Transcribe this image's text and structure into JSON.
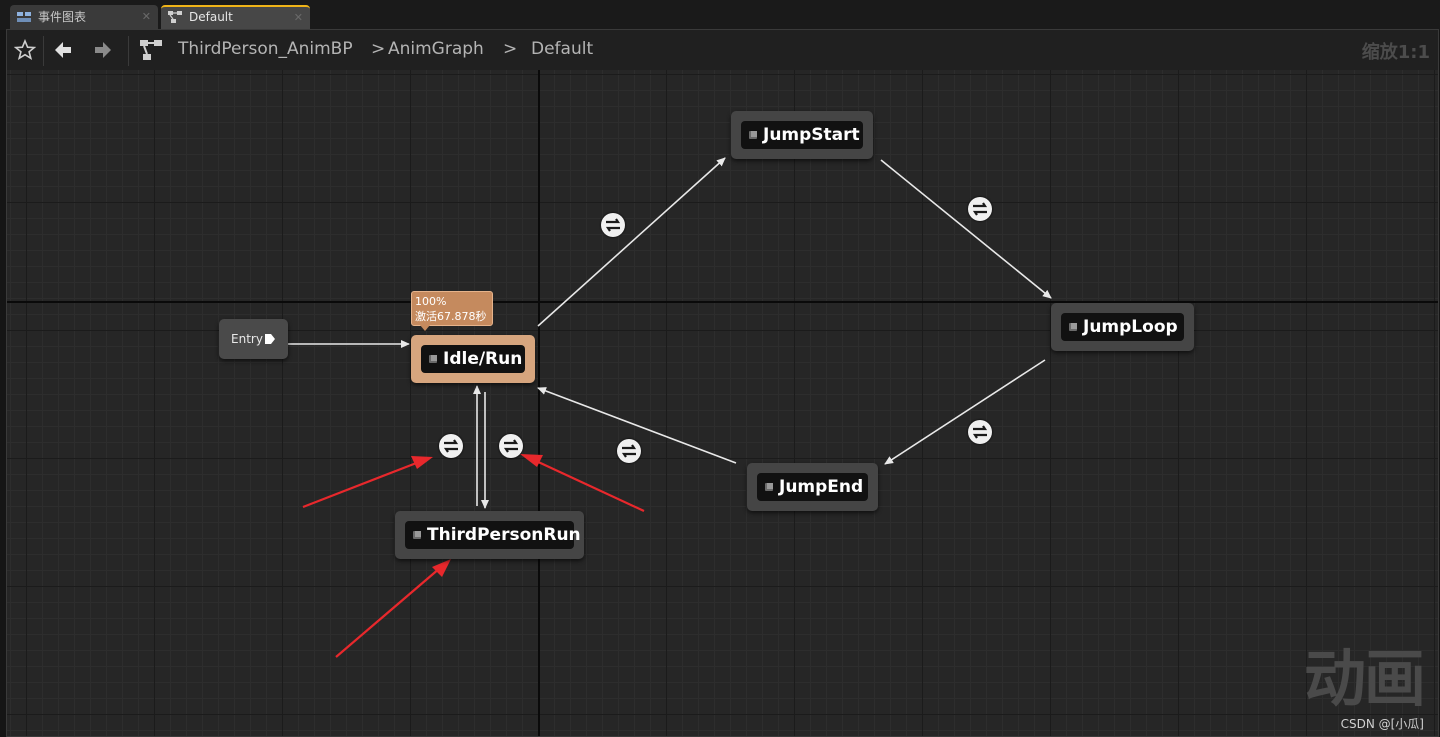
{
  "tabs": [
    {
      "label": "事件图表",
      "icon": "event-graph-icon",
      "active": false
    },
    {
      "label": "Default",
      "icon": "state-machine-icon",
      "active": true
    }
  ],
  "breadcrumb": {
    "items": [
      "ThirdPerson_AnimBP",
      "AnimGraph",
      "Default"
    ],
    "separators": [
      ">",
      ">"
    ]
  },
  "zoom_label": "缩放1:1",
  "entry": {
    "label": "Entry"
  },
  "states": {
    "idle_run": {
      "label": "Idle/Run",
      "active": true
    },
    "jump_start": {
      "label": "JumpStart"
    },
    "jump_loop": {
      "label": "JumpLoop"
    },
    "jump_end": {
      "label": "JumpEnd"
    },
    "third_person_run": {
      "label": "ThirdPersonRun"
    }
  },
  "active_tooltip": {
    "weight": "100%",
    "active_time": "激活67.878秒"
  },
  "transitions": [
    "idle_run->jump_start",
    "jump_start->jump_loop",
    "jump_loop->jump_end",
    "jump_end->idle_run",
    "idle_run->third_person_run",
    "third_person_run->idle_run"
  ],
  "colors": {
    "active_state": "#d6a57e",
    "annotation_arrow": "#e8282c",
    "tab_accent": "#f0b418"
  },
  "watermark": "动画",
  "credit": "CSDN @[小瓜]"
}
